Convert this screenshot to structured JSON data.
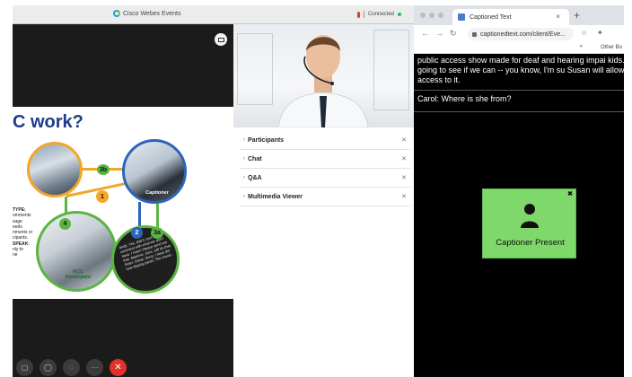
{
  "webex": {
    "title": "Cisco Webex Events",
    "status": "Connected",
    "slide": {
      "title": "C work?",
      "side_text": [
        "TYPE:",
        "omments",
        "sage",
        "eeds",
        "nments or",
        "cipants.",
        "SPEAK:",
        "nly to",
        "ne"
      ],
      "badges": {
        "b3b": "3b",
        "b1": "1",
        "b4": "4",
        "b2": "2",
        "b3a": "3a"
      },
      "captioner_label": "Captioner",
      "rcc_label": "RCC\nParticipant",
      "chat_snippet": "Andy: Yes, that's cool. Meme a comment with what we don't have. I have! Please send me that. Marlene: Sure, will do that. Peter: Great. Sorry, I have the new display panel. The visual..."
    },
    "panels": [
      {
        "label": "Participants"
      },
      {
        "label": "Chat"
      },
      {
        "label": "Q&A"
      },
      {
        "label": "Multimedia Viewer"
      }
    ],
    "toolbar": [
      "mute-button",
      "participants-button",
      "chat-button",
      "more-button",
      "end-button"
    ],
    "toolbar_glyphs": {
      "mute": "▢",
      "participants": "◯",
      "chat": "◌",
      "more": "···",
      "end": "✕"
    }
  },
  "browser": {
    "tab_title": "Captioned Text",
    "url": "captionedtext.com/client/Eve...",
    "bookmarks_other": "Other Bo",
    "caption_previous": "public access show made for deaf and hearing impai kids. So I'm going to see if we can -- you know, I'm su Susan will allow her access to it.",
    "caption_current": "Carol: Where is she from?",
    "captioner_present": "Captioner Present"
  },
  "colors": {
    "orange": "#f4a62a",
    "blue": "#2f63b8",
    "green": "#5bb544",
    "slide_title": "#1f3c88",
    "end_call": "#e0332a",
    "captioner_box": "#7fd86a"
  }
}
